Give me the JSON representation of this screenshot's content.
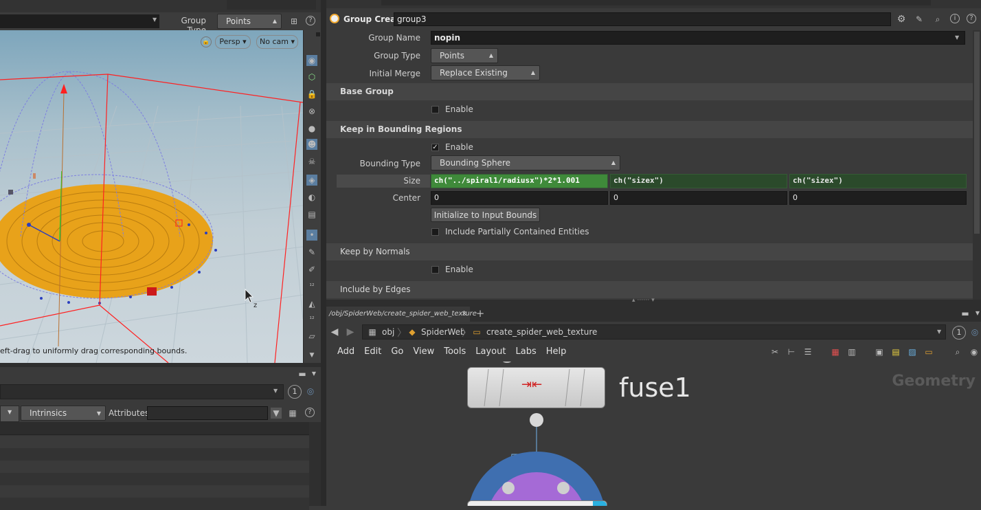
{
  "viewport": {
    "group_type_label": "Group Type",
    "group_type_value": "Points",
    "persp_label": "Persp",
    "cam_label": "No cam",
    "status_text": "eft-drag to uniformly drag corresponding bounds."
  },
  "spreadsheet": {
    "intrinsics_label": "Intrinsics",
    "attributes_label": "Attributes:",
    "attributes_value": "",
    "badge": "1"
  },
  "params": {
    "node_type": "Group Create",
    "node_name": "group3",
    "group_name_label": "Group Name",
    "group_name_value": "nopin",
    "group_type_label": "Group Type",
    "group_type_value": "Points",
    "initial_merge_label": "Initial Merge",
    "initial_merge_value": "Replace Existing",
    "base_group_title": "Base Group",
    "base_enable_label": "Enable",
    "bounding_title": "Keep in Bounding Regions",
    "bounding_enable_label": "Enable",
    "bounding_type_label": "Bounding Type",
    "bounding_type_value": "Bounding Sphere",
    "size_label": "Size",
    "size_x": "ch(\"../spiral1/radiusx\")*2*1.001",
    "size_y": "ch(\"sizex\")",
    "size_z": "ch(\"sizex\")",
    "center_label": "Center",
    "center_x": "0",
    "center_y": "0",
    "center_z": "0",
    "init_bounds_button": "Initialize to Input Bounds",
    "include_partial_label": "Include Partially Contained Entities",
    "normals_title": "Keep by Normals",
    "normals_enable_label": "Enable",
    "edges_title": "Include by Edges"
  },
  "network": {
    "tab_label": "/obj/SpiderWeb/create_spider_web_texture",
    "crumb_obj": "obj",
    "crumb_spiderweb": "SpiderWeb",
    "crumb_texture": "create_spider_web_texture",
    "badge": "1",
    "menu": [
      "Add",
      "Edit",
      "Go",
      "View",
      "Tools",
      "Layout",
      "Labs",
      "Help"
    ],
    "context_label": "Geometry",
    "node_fuse_label": "fuse1"
  },
  "colors": {
    "accent_green": "#2b4a2b",
    "bounding_box": "#ff2020",
    "web_orange": "#e8a21a",
    "node_blue": "#3f6fb0",
    "node_purple": "#a56ad6"
  }
}
